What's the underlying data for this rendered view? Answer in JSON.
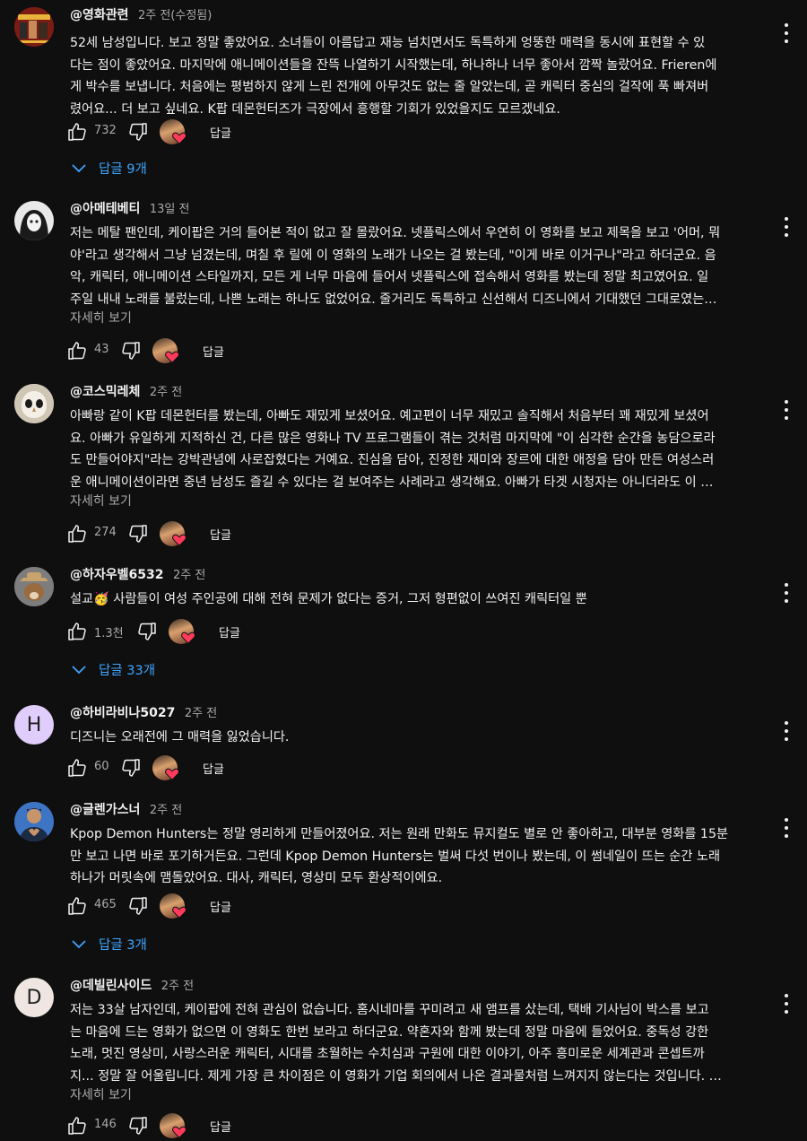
{
  "labels": {
    "read_more": "자세히 보기",
    "reply": "답글"
  },
  "comments": [
    {
      "author": "@영화관련",
      "time": "2주 전(수정됨)",
      "avatar": "movie-poster-avatar",
      "lines": [
        "52세 남성입니다. 보고 정말 좋았어요. 소녀들이 아름답고 재능 넘치면서도 독특하게 엉뚱한 매력을 동시에 표현할 수 있",
        "다는 점이 좋았어요. 마지막에 애니메이션들을 잔뜩 나열하기 시작했는데, 하나하나 너무 좋아서 깜짝 놀랐어요. Frieren에",
        "게 박수를 보냅니다. 처음에는 평범하지 않게 느린 전개에 아무것도 없는 줄 알았는데, 곧 캐릭터 중심의 걸작에 푹 빠져버",
        "렸어요... 더 보고 싶네요. K팝 데몬헌터즈가 극장에서 흥행할 기회가 있었을지도 모르겠네요."
      ],
      "likes": "732",
      "replies": "답글 9개"
    },
    {
      "author": "@아메테베티",
      "time": "13일 전",
      "avatar": "gothic-girl-avatar",
      "lines": [
        "저는 메탈 팬인데, 케이팝은 거의 들어본 적이 없고 잘 몰랐어요. 넷플릭스에서 우연히 이 영화를 보고 제목을 보고 '어머, 뭐",
        "야'라고 생각해서 그냥 넘겼는데, 며칠 후 릴에 이 영화의 노래가 나오는 걸 봤는데, \"이게 바로 이거구나\"라고 하더군요. 음",
        "악, 캐릭터, 애니메이션 스타일까지, 모든 게 너무 마음에 들어서 넷플릭스에 접속해서 영화를 봤는데 정말 최고였어요. 일",
        "주일 내내 노래를 불렀는데, 나쁜 노래는 하나도 없었어요. 줄거리도 독특하고 신선해서 디즈니에서 기대했던 그대로였는…"
      ],
      "likes": "43"
    },
    {
      "author": "@코스믹레체",
      "time": "2주 전",
      "avatar": "owl-avatar",
      "lines": [
        "아빠랑 같이 K팝 데몬헌터를 봤는데, 아빠도 재밌게 보셨어요. 예고편이 너무 재밌고 솔직해서 처음부터 꽤 재밌게 보셨어",
        "요. 아빠가 유일하게 지적하신 건, 다른 많은 영화나 TV 프로그램들이 겪는 것처럼 마지막에 \"이 심각한 순간을 농담으로라",
        "도 만들어야지\"라는 강박관념에 사로잡혔다는 거예요. 진심을 담아, 진정한 재미와 장르에 대한 애정을 담아 만든 여성스러",
        "운 애니메이션이라면 중년 남성도 즐길 수 있다는 걸 보여주는 사례라고 생각해요. 아빠가 타겟 시청자는 아니더라도 이 …"
      ],
      "likes": "274"
    },
    {
      "author": "@하자우벨6532",
      "time": "2주 전",
      "avatar": "cowboy-dog-avatar",
      "lines": [
        "설교🥳 사람들이 여성 주인공에 대해 전혀 문제가 없다는 증거, 그저 형편없이 쓰여진 캐릭터일 뿐"
      ],
      "likes": "1.3천",
      "replies": "답글 33개"
    },
    {
      "author": "@하비라비나5027",
      "time": "2주 전",
      "avatar_letter": "H",
      "lines": [
        "디즈니는 오래전에 그 매력을 잃었습니다."
      ],
      "likes": "60"
    },
    {
      "author": "@글렌가스너",
      "time": "2주 전",
      "avatar": "man-heart-hands-avatar",
      "lines": [
        "Kpop Demon Hunters는 정말 영리하게 만들어졌어요. 저는 원래 만화도 뮤지컬도 별로 안 좋아하고, 대부분 영화를 15분",
        "만 보고 나면 바로 포기하거든요. 그런데 Kpop Demon Hunters는 벌써 다섯 번이나 봤는데, 이 썸네일이 뜨는 순간 노래",
        "하나가 머릿속에 맴돌았어요. 대사, 캐릭터, 영상미 모두 환상적이에요."
      ],
      "likes": "465",
      "replies": "답글 3개"
    },
    {
      "author": "@데빌린사이드",
      "time": "2주 전",
      "avatar_letter": "D",
      "lines": [
        "저는 33살 남자인데, 케이팝에 전혀 관심이 없습니다. 홈시네마를 꾸미려고 새 앰프를 샀는데, 택배 기사님이 박스를 보고",
        "는 마음에 드는 영화가 없으면 이 영화도 한번 보라고 하더군요. 약혼자와 함께 봤는데 정말 마음에 들었어요. 중독성 강한",
        "노래, 멋진 영상미, 사랑스러운 캐릭터, 시대를 초월하는 수치심과 구원에 대한 이야기, 아주 흥미로운 세계관과 콘셉트까",
        "지... 정말 잘 어울립니다. 제게 가장 큰 차이점은 이 영화가 기업 회의에서 나온 결과물처럼 느껴지지 않는다는 것입니다. …"
      ],
      "likes": "146"
    }
  ],
  "colors": {
    "background": "#0f0f0f",
    "text": "#f1f1f1",
    "muted": "#aaaaaa",
    "link": "#3ea6ff",
    "heart": "#ff3b5c"
  }
}
